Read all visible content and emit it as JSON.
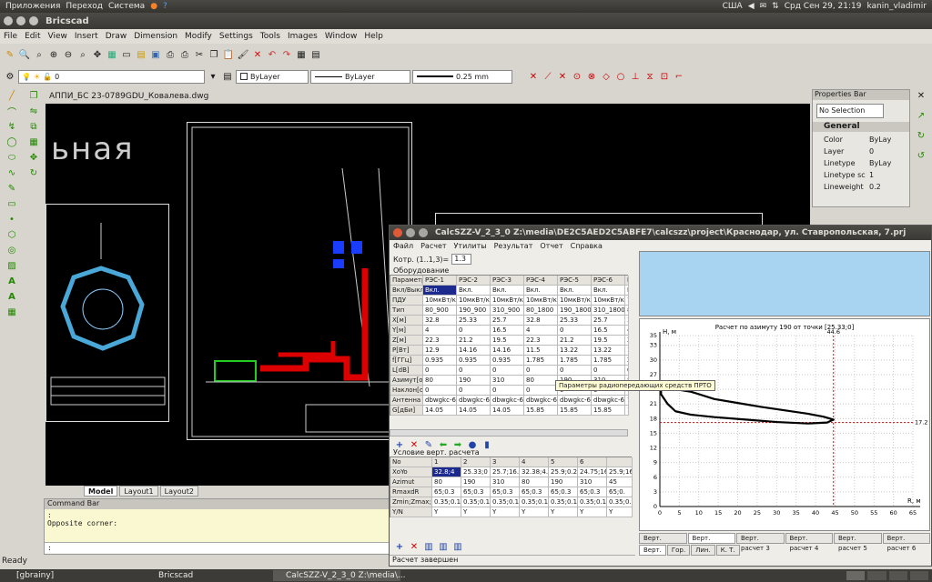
{
  "system": {
    "menu": [
      "Приложения",
      "Переход",
      "Система"
    ],
    "tray": {
      "layout": "США",
      "datetime": "Срд Сен 29, 21:19",
      "user": "kanin_vladimir"
    }
  },
  "bricscad": {
    "title": "Bricscad",
    "menu": [
      "File",
      "Edit",
      "View",
      "Insert",
      "Draw",
      "Dimension",
      "Modify",
      "Settings",
      "Tools",
      "Images",
      "Window",
      "Help"
    ],
    "layer_value": "0",
    "color_value": "ByLayer",
    "linetype_value": "ByLayer",
    "lineweight_value": "0.25 mm",
    "doc_title": "АППИ_БС 23-0789GDU_Ковалева.dwg",
    "cad_big_text": "ьная",
    "layout_tabs": [
      "Model",
      "Layout1",
      "Layout2"
    ],
    "command_bar": {
      "title": "Command Bar",
      "lines": [
        ":",
        "Opposite corner:"
      ],
      "prompt": ":"
    },
    "status": "Ready",
    "properties": {
      "title": "Properties Bar",
      "selection": "No Selection",
      "section": "General",
      "rows": [
        [
          "Color",
          "ByLay"
        ],
        [
          "Layer",
          "0"
        ],
        [
          "Linetype",
          "ByLay"
        ],
        [
          "Linetype sc",
          "1"
        ],
        [
          "Lineweight",
          "0.2"
        ]
      ]
    }
  },
  "calc": {
    "title": "CalcSZZ-V_2_3_0 Z:\\media\\DE2C5AED2C5ABFE7\\calcszz\\project\\Краснодар, ул. Ставропольская, 7.prj",
    "menu": [
      "Файл",
      "Расчет",
      "Утилиты",
      "Результат",
      "Отчет",
      "Справка"
    ],
    "korr_label": "Котр. (1..1,3)=",
    "korr_value": "1.3",
    "equip_title": "Оборудование",
    "equip_header": [
      "Параметр",
      "РЭС-1",
      "РЭС-2",
      "РЭС-3",
      "РЭС-4",
      "РЭС-5",
      "РЭС-6",
      "РЭ"
    ],
    "equip_rows": [
      [
        "Вкл/Выкл",
        "Вкл.",
        "Вкл.",
        "Вкл.",
        "Вкл.",
        "Вкл.",
        "Вкл.",
        "Вк"
      ],
      [
        "ПДУ",
        "10мкВт/кв",
        "10мкВт/кв",
        "10мкВт/кв",
        "10мкВт/кв",
        "10мкВт/кв",
        "10мкВт/кв",
        "10"
      ],
      [
        "Тип",
        "80_900",
        "190_900",
        "310_900",
        "80_1800",
        "190_1800",
        "310_1800",
        "80"
      ],
      [
        "X[м]",
        "32.8",
        "25.33",
        "25.7",
        "32.8",
        "25.33",
        "25.7",
        "32."
      ],
      [
        "Y[м]",
        "4",
        "0",
        "16.5",
        "4",
        "0",
        "16.5",
        "4.8"
      ],
      [
        "Z[м]",
        "22.3",
        "21.2",
        "19.5",
        "22.3",
        "21.2",
        "19.5",
        "22."
      ],
      [
        "P[Вт]",
        "12.9",
        "14.16",
        "14.16",
        "11.5",
        "13.22",
        "13.22",
        "11."
      ],
      [
        "f[ГГц]",
        "0.935",
        "0.935",
        "0.935",
        "1.785",
        "1.785",
        "1.785",
        "2.1"
      ],
      [
        "L[dB]",
        "0",
        "0",
        "0",
        "0",
        "0",
        "0",
        "0"
      ],
      [
        "Азимут[о]",
        "80",
        "190",
        "310",
        "80",
        "190",
        "310",
        "80"
      ],
      [
        "Наклон[о]",
        "0",
        "0",
        "0",
        "0",
        "0",
        "0",
        "0"
      ],
      [
        "Антенна",
        "dbwgkc-65E",
        "dbwgkc-65E",
        "dbwgkc-65E",
        "dbwgkc-65E",
        "dbwgkc-65E",
        "dbwgkc-65E",
        "742"
      ],
      [
        "G[дБи]",
        "14.05",
        "14.05",
        "14.05",
        "15.85",
        "15.85",
        "15.85",
        "15."
      ]
    ],
    "tooltip": "Параметры радиопередающих средств ПРТО",
    "cond_title": "Условие верт. расчета",
    "cond_header": [
      "No",
      "1",
      "2",
      "3",
      "4",
      "5",
      "6"
    ],
    "cond_rows": [
      [
        "XoYo",
        "32.8;4",
        "25.33;0",
        "25.7;16.5",
        "32.38;4.8",
        "25.9;0.25",
        "24.75;16.5",
        "25.9;16.5"
      ],
      [
        "Azimut",
        "80",
        "190",
        "310",
        "80",
        "190",
        "310",
        "45"
      ],
      [
        "RmaxdR",
        "65;0.3",
        "65;0.3",
        "65;0.3",
        "65;0.3",
        "65;0.3",
        "65;0.3",
        "65;0."
      ],
      [
        "Zmin;Zmax;dZ",
        "0.35;0.1",
        "0.35;0.1",
        "0.35;0.1",
        "0.35;0.1",
        "0.35;0.1",
        "0.35;0.1",
        "0.35;0."
      ],
      [
        "Y/N",
        "Y",
        "Y",
        "Y",
        "Y",
        "Y",
        "Y",
        "Y"
      ]
    ],
    "status": "Расчет завершен",
    "chart_tabs": [
      "Верт. расчет 1",
      "Верт. расчет 2",
      "Верт. расчет 3",
      "Верт. расчет 4",
      "Верт. расчет 5",
      "Верт. расчет 6"
    ],
    "bottom_tabs": [
      "Верт.",
      "Гор.",
      "Лин.",
      "К. Т."
    ]
  },
  "chart_data": {
    "type": "line",
    "title": "Расчет по азимуту 190 от точки [25.33;0]",
    "xlabel": "R, м",
    "ylabel": "H, м",
    "xlim": [
      0,
      65
    ],
    "ylim": [
      0,
      35
    ],
    "xticks": [
      0,
      5,
      10,
      15,
      20,
      25,
      30,
      35,
      40,
      45,
      50,
      55,
      60,
      65
    ],
    "yticks": [
      0,
      3,
      6,
      9,
      12,
      15,
      18,
      21,
      24,
      27,
      30,
      33,
      35
    ],
    "markers": {
      "x_value": "44.6",
      "y_value": "17.2"
    },
    "marker_x": 44.6,
    "marker_y": 17.2,
    "series": [
      {
        "x": [
          0.3,
          2,
          4,
          8,
          14,
          20,
          26,
          32,
          38,
          42,
          44.6,
          43,
          38,
          30,
          22,
          14,
          8,
          4,
          2,
          0.3
        ],
        "y": [
          25,
          25.3,
          24,
          23.5,
          22,
          21.2,
          20.4,
          19.7,
          19,
          18.4,
          17.8,
          17.2,
          17,
          17.3,
          17.8,
          18.3,
          18.8,
          19.5,
          21,
          23
        ]
      }
    ],
    "color": "#000000"
  },
  "taskbar": [
    "[gbrainy]",
    "Bricscad",
    "CalcSZZ-V_2_3_0 Z:\\media\\..."
  ]
}
